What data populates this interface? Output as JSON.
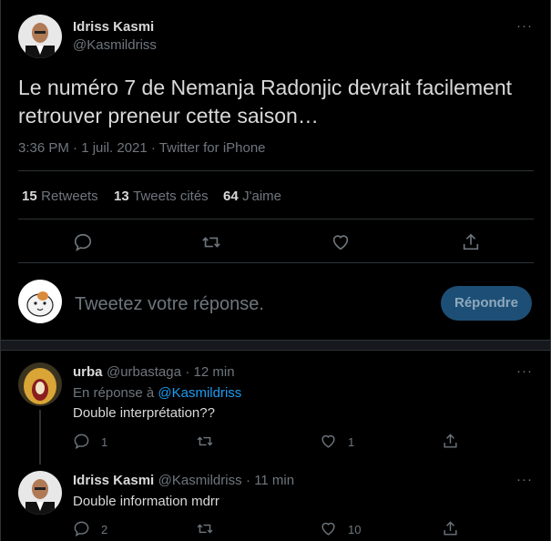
{
  "main_tweet": {
    "author_name": "Idriss Kasmi",
    "author_handle": "@Kasmildriss",
    "text": "Le numéro 7 de Nemanja Radonjic devrait facilement retrouver preneur cette saison…",
    "meta": "3:36 PM · 1 juil. 2021 · Twitter for iPhone",
    "retweets_count": "15",
    "retweets_label": "Retweets",
    "quotes_count": "13",
    "quotes_label": "Tweets cités",
    "likes_count": "64",
    "likes_label": "J'aime",
    "more": "···"
  },
  "composer": {
    "placeholder": "Tweetez votre réponse.",
    "button_label": "Répondre"
  },
  "replies": [
    {
      "author_name": "urba",
      "author_handle": "@urbastaga",
      "time": "· 12 min",
      "reply_prefix": "En réponse à",
      "reply_to": "@Kasmildriss",
      "text": "Double interprétation??",
      "reply_count": "1",
      "like_count": "1",
      "more": "···"
    },
    {
      "author_name": "Idriss Kasmi",
      "author_handle": "@Kasmildriss",
      "time": "· 11 min",
      "text": "Double information mdrr",
      "reply_count": "2",
      "like_count": "10",
      "more": "···"
    }
  ],
  "icons": {
    "reply": "reply-icon",
    "retweet": "retweet-icon",
    "like": "heart-icon",
    "share": "share-icon"
  },
  "colors": {
    "background": "#000000",
    "accent": "#1d9bf0",
    "muted": "#6e767d",
    "divider": "#2f3336",
    "button_bg": "#1d4f76"
  }
}
